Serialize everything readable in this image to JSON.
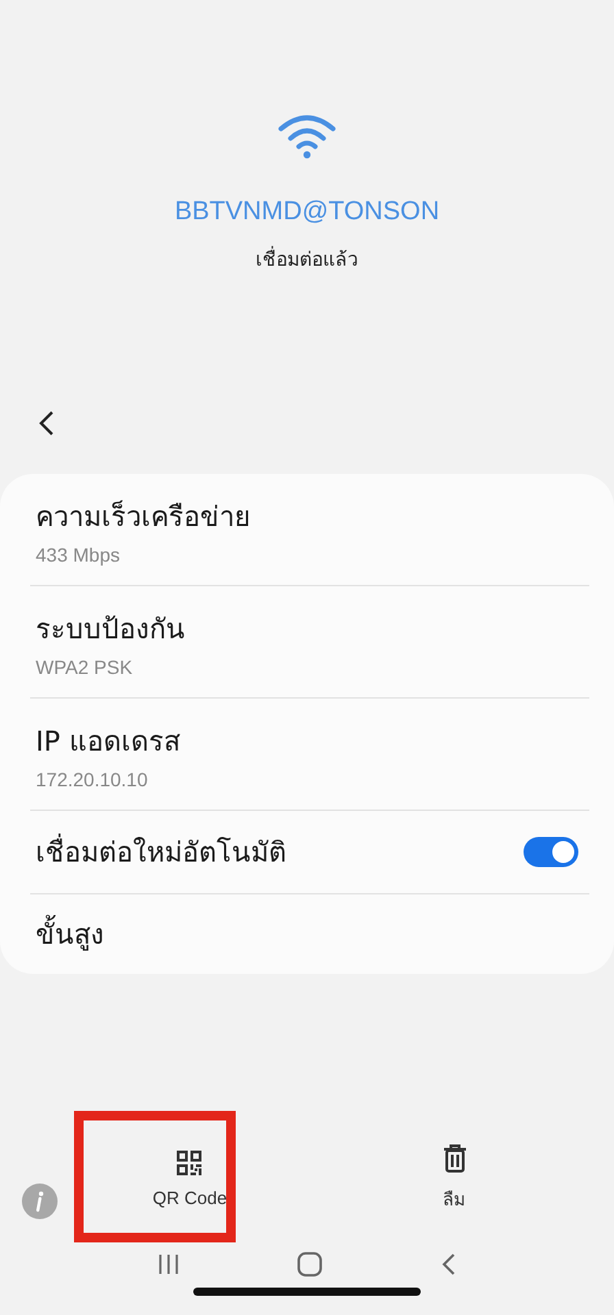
{
  "network": {
    "name": "BBTVNMD@TONSON",
    "status": "เชื่อมต่อแล้ว"
  },
  "details": [
    {
      "kind": "info",
      "title": "ความเร็วเครือข่าย",
      "value": "433 Mbps"
    },
    {
      "kind": "info",
      "title": "ระบบป้องกัน",
      "value": "WPA2 PSK"
    },
    {
      "kind": "info",
      "title": "IP แอดเดรส",
      "value": "172.20.10.10"
    },
    {
      "kind": "toggle",
      "title": "เชื่อมต่อใหม่อัตโนมัติ",
      "on": true
    },
    {
      "kind": "link",
      "title": "ขั้นสูง"
    }
  ],
  "actions": [
    {
      "kind": "qr",
      "label": "QR Code",
      "highlighted": true
    },
    {
      "kind": "trash",
      "label": "ลืม",
      "highlighted": false
    }
  ]
}
